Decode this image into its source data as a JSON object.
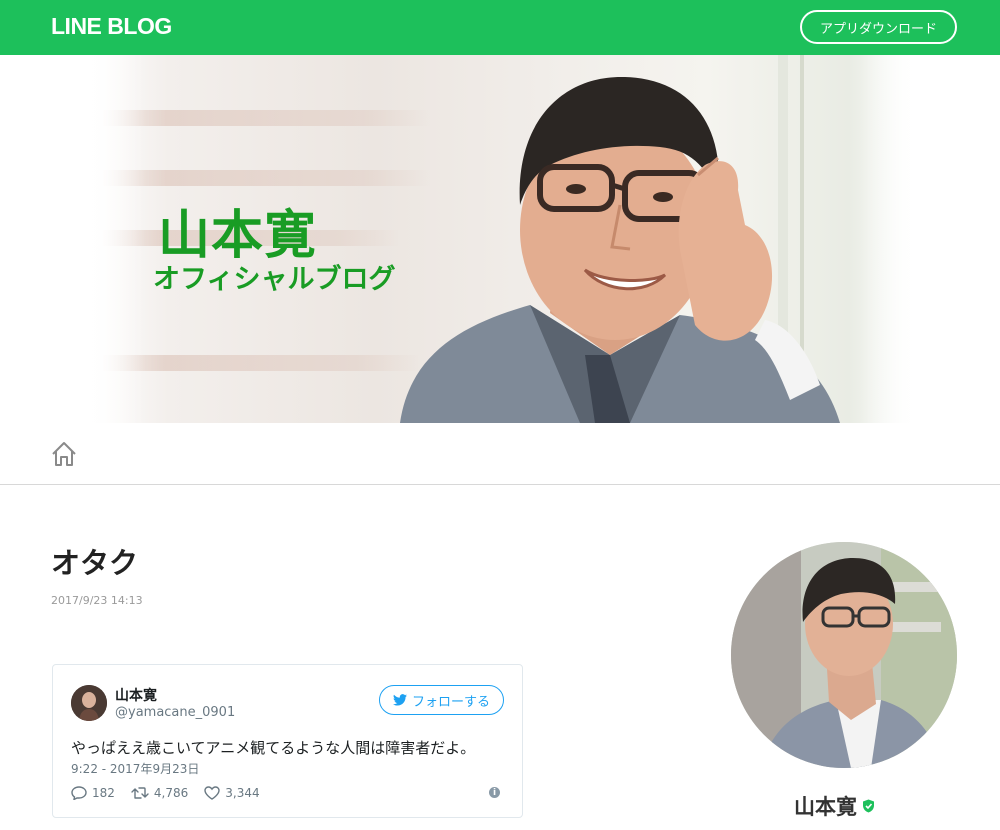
{
  "header": {
    "logo_text": "LINE BLOG",
    "download_button": "アプリダウンロード",
    "background_color": "#1dc05b"
  },
  "banner": {
    "title": "山本寛",
    "subtitle": "オフィシャルブログ",
    "text_color": "#199c24"
  },
  "nav": {
    "home_icon": "home-icon"
  },
  "post": {
    "title": "オタク",
    "date": "2017/9/23 14:13"
  },
  "tweet": {
    "author_name": "山本寛",
    "author_handle": "@yamacane_0901",
    "follow_label": "フォローする",
    "text": "やっぱええ歳こいてアニメ観てるような人間は障害者だよ。",
    "timestamp": "9:22 - 2017年9月23日",
    "replies": "182",
    "retweets": "4,786",
    "likes": "3,344",
    "accent_color": "#1da1f2"
  },
  "sidebar": {
    "profile_name": "山本寛",
    "verified_icon": "shield-check-icon"
  }
}
